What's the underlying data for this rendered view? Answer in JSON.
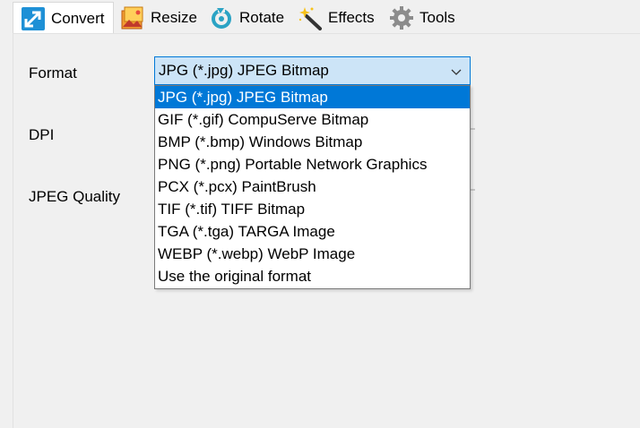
{
  "tabs": [
    {
      "label": "Convert",
      "icon": "convert-arrows-icon",
      "active": true
    },
    {
      "label": "Resize",
      "icon": "resize-image-icon",
      "active": false
    },
    {
      "label": "Rotate",
      "icon": "rotate-icon",
      "active": false
    },
    {
      "label": "Effects",
      "icon": "magic-wand-icon",
      "active": false
    },
    {
      "label": "Tools",
      "icon": "gear-icon",
      "active": false
    }
  ],
  "fields": {
    "format_label": "Format",
    "dpi_label": "DPI",
    "quality_label": "JPEG Quality"
  },
  "format_select": {
    "value": "JPG (*.jpg) JPEG Bitmap",
    "options": [
      "JPG (*.jpg) JPEG Bitmap",
      "GIF (*.gif) CompuServe Bitmap",
      "BMP (*.bmp) Windows Bitmap",
      "PNG (*.png) Portable Network Graphics",
      "PCX (*.pcx) PaintBrush",
      "TIF (*.tif) TIFF Bitmap",
      "TGA (*.tga) TARGA Image",
      "WEBP (*.webp) WebP Image",
      "Use the original format"
    ],
    "selected_index": 0
  },
  "colors": {
    "accent": "#0078d7",
    "combo_bg": "#cce4f7"
  }
}
